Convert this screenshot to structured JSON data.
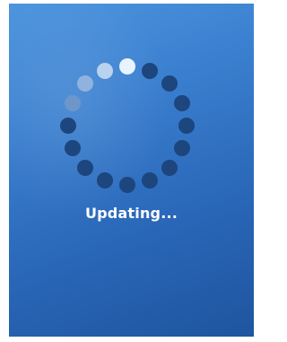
{
  "status": {
    "text": "Updating..."
  },
  "spinner": {
    "icon": "loading-spinner-icon",
    "dot_count": 16,
    "active_color": "#e8f3ff",
    "trail_colors": [
      "#b9d3ee",
      "#8fb3dc",
      "#6d97cb"
    ],
    "inactive_color": "#1c467d"
  },
  "colors": {
    "background_top": "#4d95de",
    "background_bottom": "#1e559f"
  }
}
